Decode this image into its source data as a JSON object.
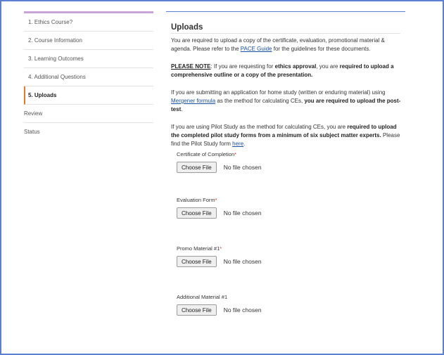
{
  "sidebar": {
    "items": [
      {
        "label": "1. Ethics Course?"
      },
      {
        "label": "2. Course Information"
      },
      {
        "label": "3. Learning Outcomes"
      },
      {
        "label": "4. Additional Questions"
      },
      {
        "label": "5. Uploads"
      },
      {
        "label": "Review"
      },
      {
        "label": "Status"
      }
    ],
    "active_index": 4,
    "accent_color": "#e07b2a"
  },
  "main": {
    "title": "Uploads",
    "intro": {
      "text_before": "You are required to upload a copy of the certificate, evaluation, promotional material & agenda. Please refer to the ",
      "link": "PACE Guide",
      "text_after": " for the guidelines for these documents."
    },
    "note": {
      "label": "PLEASE NOTE",
      "text1": ": If you are requesting for ",
      "bold1": "ethics approval",
      "text2": ", you are ",
      "bold2": "required to upload a comprehensive outline or a copy of the presentation."
    },
    "home_study": {
      "text1": "If you are submitting an application for home study (written or enduring material) using ",
      "link": "Mergener formula",
      "text2": " as the method for calculating CEs, ",
      "bold": "you are required to upload the post-test",
      "text3": "."
    },
    "pilot": {
      "text1": "If you are using Pilot Study as the method for calculating CEs, you are ",
      "bold": "required to upload the completed pilot study forms from a minimum of six subject matter experts.",
      "text2": " Please find the Pilot Study form ",
      "link": "here",
      "text3": "."
    },
    "uploads": [
      {
        "label": "Certificate of Completion",
        "required_mark": "*",
        "button": "Choose File",
        "status": "No file chosen"
      },
      {
        "label": "Evaluation Form",
        "required_mark": "*",
        "button": "Choose File",
        "status": "No file chosen"
      },
      {
        "label": "Promo Material #1",
        "required_mark": "*",
        "button": "Choose File",
        "status": "No file chosen"
      },
      {
        "label": "Additional Material #1",
        "required_mark": "",
        "button": "Choose File",
        "status": "No file chosen"
      }
    ]
  },
  "colors": {
    "frame_border": "#5b7fd1",
    "link": "#1a4fa0",
    "required": "#d2322d"
  }
}
